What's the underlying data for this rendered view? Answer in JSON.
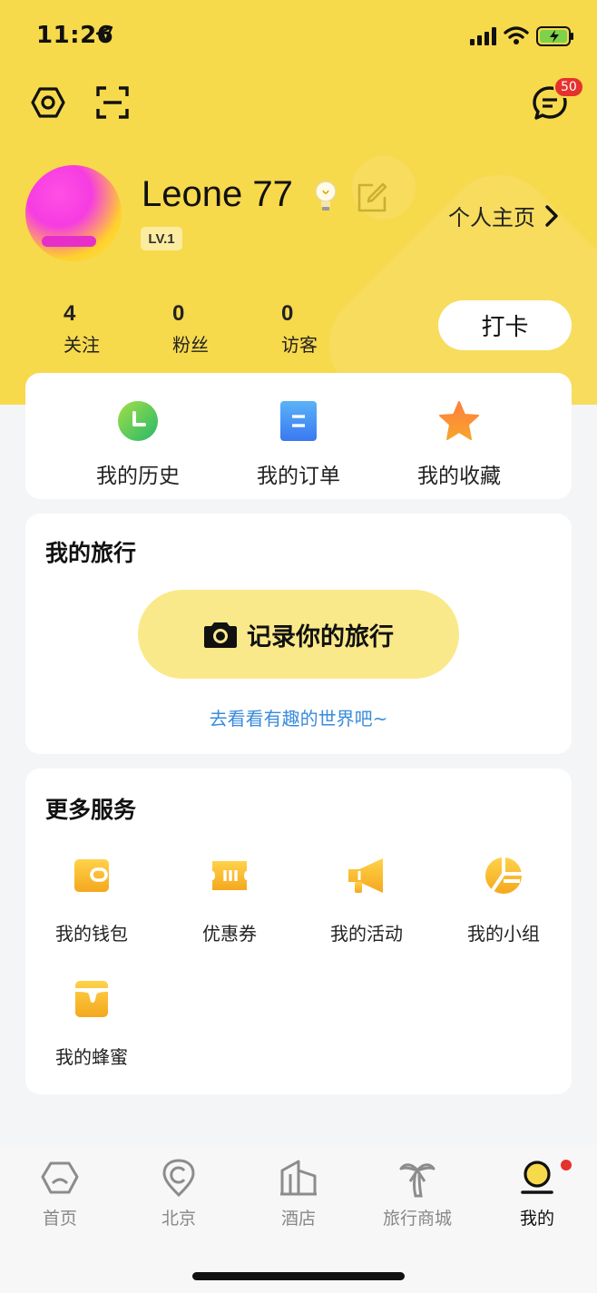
{
  "status_bar": {
    "time": "11:26"
  },
  "header": {
    "message_badge": "50",
    "username": "Leone 77",
    "level": "LV.1",
    "homepage_label": "个人主页"
  },
  "stats": [
    {
      "value": "4",
      "label": "关注"
    },
    {
      "value": "0",
      "label": "粉丝"
    },
    {
      "value": "0",
      "label": "访客"
    }
  ],
  "checkin_label": "打卡",
  "quick_links": [
    {
      "label": "我的历史",
      "icon": "clock-icon"
    },
    {
      "label": "我的订单",
      "icon": "order-icon"
    },
    {
      "label": "我的收藏",
      "icon": "star-icon"
    }
  ],
  "travel": {
    "title": "我的旅行",
    "record_label": "记录你的旅行",
    "explore_label": "去看看有趣的世界吧~"
  },
  "services": {
    "title": "更多服务",
    "items": [
      {
        "label": "我的钱包",
        "icon": "wallet-icon"
      },
      {
        "label": "优惠券",
        "icon": "coupon-icon"
      },
      {
        "label": "我的活动",
        "icon": "megaphone-icon"
      },
      {
        "label": "我的小组",
        "icon": "group-icon"
      },
      {
        "label": "我的蜂蜜",
        "icon": "honey-icon"
      }
    ]
  },
  "tabbar": [
    {
      "label": "首页",
      "icon": "home-icon"
    },
    {
      "label": "北京",
      "icon": "location-icon"
    },
    {
      "label": "酒店",
      "icon": "hotel-icon"
    },
    {
      "label": "旅行商城",
      "icon": "palm-tree-icon"
    },
    {
      "label": "我的",
      "icon": "profile-icon",
      "active": true
    }
  ],
  "colors": {
    "brand_yellow": "#f7d94c",
    "badge_red": "#e5322d",
    "link_blue": "#3a8bdc"
  }
}
